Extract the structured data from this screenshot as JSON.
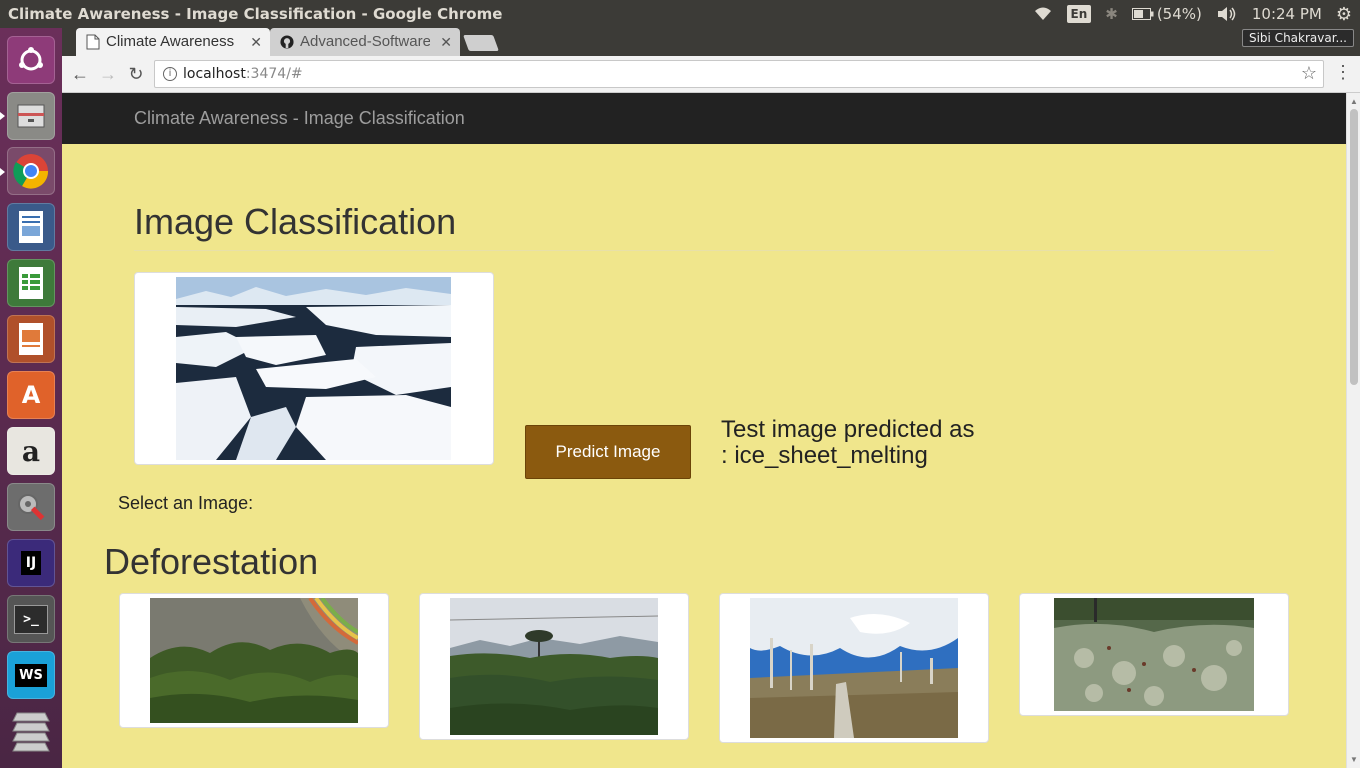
{
  "system": {
    "window_title": "Climate Awareness - Image Classification - Google Chrome",
    "input_method": "En",
    "battery": "(54%)",
    "clock": "10:24 PM",
    "user": "Sibi Chakravar..."
  },
  "launcher": {
    "items": [
      {
        "icon": "ubuntu-dash-icon"
      },
      {
        "icon": "files-icon"
      },
      {
        "icon": "chrome-icon"
      },
      {
        "icon": "libreoffice-writer-icon"
      },
      {
        "icon": "libreoffice-calc-icon"
      },
      {
        "icon": "libreoffice-impress-icon"
      },
      {
        "icon": "software-center-icon",
        "label": "A"
      },
      {
        "icon": "amazon-icon",
        "label": "a"
      },
      {
        "icon": "system-settings-icon"
      },
      {
        "icon": "intellij-icon",
        "label": "IJ"
      },
      {
        "icon": "terminal-icon",
        "label": ">_"
      },
      {
        "icon": "webstorm-icon",
        "label": "WS"
      },
      {
        "icon": "workspaces-icon"
      }
    ]
  },
  "browser": {
    "tabs": [
      {
        "title": "Climate Awareness - Image Classification",
        "active": true,
        "icon": "page-icon"
      },
      {
        "title": "Advanced-Software-Engineering",
        "active": false,
        "icon": "github-icon"
      }
    ],
    "url_host": "localhost",
    "url_rest": ":3474/#"
  },
  "page": {
    "brand": "Climate Awareness - Image Classification",
    "heading": "Image Classification",
    "predict_button": "Predict Image",
    "prediction_line1": "Test image predicted as",
    "prediction_line2": ": ice_sheet_melting",
    "select_label": "Select an Image:",
    "section_title": "Deforestation"
  },
  "colors": {
    "page_bg": "#f0e68c",
    "navbar_bg": "#222222",
    "button_bg": "#8b5a0f"
  }
}
